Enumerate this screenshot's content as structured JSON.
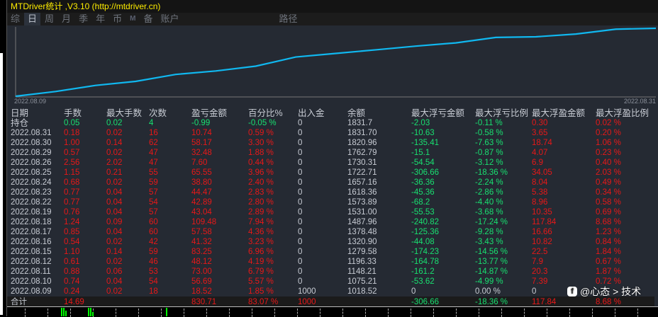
{
  "title": "MTDriver统计 ,V3.10 (http://mtdriver.cn)",
  "tabs": [
    "综",
    "日",
    "周",
    "月",
    "季",
    "年",
    "币",
    "M",
    "备",
    "账户",
    "路径"
  ],
  "active_tab": "日",
  "chart_data": {
    "type": "line",
    "title": "",
    "x_labels": [
      "2022.08.09",
      "2022.08.31"
    ],
    "dates": [
      "2022.08.09",
      "2022.08.10",
      "2022.08.11",
      "2022.08.12",
      "2022.08.15",
      "2022.08.16",
      "2022.08.17",
      "2022.08.18",
      "2022.08.19",
      "2022.08.22",
      "2022.08.23",
      "2022.08.24",
      "2022.08.25",
      "2022.08.26",
      "2022.08.29",
      "2022.08.30",
      "2022.08.31"
    ],
    "balance": [
      1018.52,
      1075.21,
      1148.21,
      1196.33,
      1279.58,
      1320.9,
      1378.48,
      1487.96,
      1531.0,
      1573.89,
      1618.36,
      1657.16,
      1722.71,
      1730.31,
      1762.79,
      1820.96,
      1831.7
    ],
    "color": "#10b8f0"
  },
  "table": {
    "headers": [
      "日期",
      "手数",
      "最大手数",
      "次数",
      "盈亏金额",
      "百分比%",
      "出入金",
      "余额",
      "最大浮亏金额",
      "最大浮亏比例",
      "最大浮盈金额",
      "最大浮盈比例"
    ],
    "holding": [
      "持仓",
      "0.05",
      "0.02",
      "4",
      "-0.99",
      "-0.05 %",
      "0",
      "1831.7",
      "-2.03",
      "-0.11 %",
      "0.30",
      "0.02 %"
    ],
    "rows": [
      [
        "2022.08.31",
        "0.18",
        "0.02",
        "16",
        "10.74",
        "0.59 %",
        "0",
        "1831.70",
        "-10.63",
        "-0.58 %",
        "3.65",
        "0.20 %"
      ],
      [
        "2022.08.30",
        "1.00",
        "0.14",
        "62",
        "58.17",
        "3.30 %",
        "0",
        "1820.96",
        "-135.41",
        "-7.63 %",
        "18.74",
        "1.06 %"
      ],
      [
        "2022.08.29",
        "0.57",
        "0.02",
        "47",
        "32.48",
        "1.88 %",
        "0",
        "1762.79",
        "-15.1",
        "-0.87 %",
        "4.07",
        "0.23 %"
      ],
      [
        "2022.08.26",
        "2.56",
        "2.02",
        "47",
        "7.60",
        "0.44 %",
        "0",
        "1730.31",
        "-54.54",
        "-3.12 %",
        "6.9",
        "0.40 %"
      ],
      [
        "2022.08.25",
        "1.15",
        "0.21",
        "55",
        "65.55",
        "3.96 %",
        "0",
        "1722.71",
        "-306.66",
        "-18.36 %",
        "34.05",
        "2.03 %"
      ],
      [
        "2022.08.24",
        "0.68",
        "0.02",
        "59",
        "38.80",
        "2.40 %",
        "0",
        "1657.16",
        "-36.36",
        "-2.24 %",
        "8.04",
        "0.49 %"
      ],
      [
        "2022.08.23",
        "0.77",
        "0.04",
        "57",
        "44.47",
        "2.83 %",
        "0",
        "1618.36",
        "-45.36",
        "-2.86 %",
        "5.38",
        "0.34 %"
      ],
      [
        "2022.08.22",
        "0.77",
        "0.04",
        "54",
        "42.89",
        "2.80 %",
        "0",
        "1573.89",
        "-68.2",
        "-4.40 %",
        "8.96",
        "0.58 %"
      ],
      [
        "2022.08.19",
        "0.76",
        "0.04",
        "57",
        "43.04",
        "2.89 %",
        "0",
        "1531.00",
        "-55.53",
        "-3.68 %",
        "10.35",
        "0.69 %"
      ],
      [
        "2022.08.18",
        "1.24",
        "0.09",
        "60",
        "109.48",
        "7.94 %",
        "0",
        "1487.96",
        "-240.82",
        "-17.24 %",
        "117.84",
        "8.68 %"
      ],
      [
        "2022.08.17",
        "0.85",
        "0.04",
        "60",
        "57.58",
        "4.36 %",
        "0",
        "1378.48",
        "-125.36",
        "-9.28 %",
        "16.66",
        "1.23 %"
      ],
      [
        "2022.08.16",
        "0.54",
        "0.02",
        "42",
        "41.32",
        "3.23 %",
        "0",
        "1320.90",
        "-44.08",
        "-3.43 %",
        "10.82",
        "0.84 %"
      ],
      [
        "2022.08.15",
        "1.10",
        "0.14",
        "59",
        "83.25",
        "6.96 %",
        "0",
        "1279.58",
        "-174.23",
        "-14.56 %",
        "22.5",
        "1.84 %"
      ],
      [
        "2022.08.12",
        "0.61",
        "0.02",
        "46",
        "48.12",
        "4.19 %",
        "0",
        "1196.33",
        "-164.78",
        "-13.77 %",
        "7.9",
        "0.67 %"
      ],
      [
        "2022.08.11",
        "0.88",
        "0.06",
        "53",
        "73.00",
        "6.79 %",
        "0",
        "1148.21",
        "-161.2",
        "-14.87 %",
        "20.3",
        "1.87 %"
      ],
      [
        "2022.08.10",
        "0.74",
        "0.04",
        "54",
        "56.69",
        "5.57 %",
        "0",
        "1075.21",
        "-53.62",
        "-4.99 %",
        "7.39",
        "0.72 %"
      ],
      [
        "2022.08.09",
        "0.24",
        "0.02",
        "18",
        "18.52",
        "1.85 %",
        "1000",
        "1018.52",
        "0",
        "0.00 %",
        "0",
        ""
      ]
    ],
    "total": [
      "合计",
      "14.69",
      "",
      "",
      "830.71",
      "83.07 %",
      "1000",
      "",
      "-306.66",
      "-18.36 %",
      "117.84",
      "8.68 %"
    ]
  },
  "watermark": "@心态 > 技术",
  "colors": {
    "profit": "#e81818",
    "loss": "#18e070",
    "text": "#c8ccd4"
  }
}
